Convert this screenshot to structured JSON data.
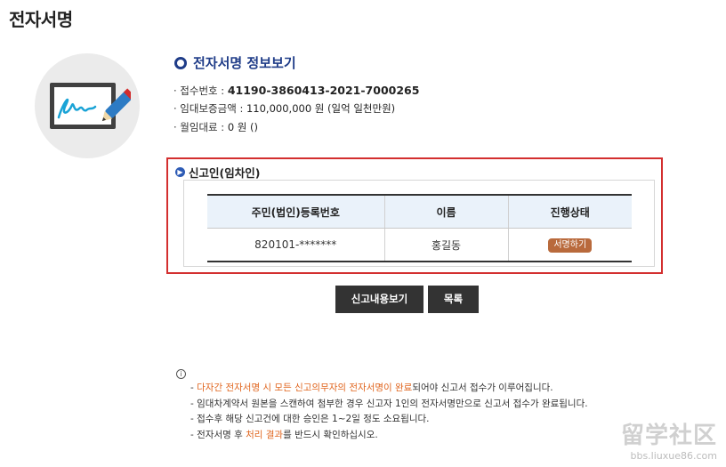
{
  "page": {
    "title": "전자서명"
  },
  "info": {
    "title": "전자서명 정보보기",
    "rows": [
      {
        "label": "· 접수번호 : ",
        "value": "41190-3860413-2021-7000265",
        "strong": true
      },
      {
        "label": "· 임대보증금액 : ",
        "value": "110,000,000 원 (일억 일천만원)",
        "strong": false
      },
      {
        "label": "· 월임대료 : ",
        "value": "0 원 ()",
        "strong": false
      }
    ]
  },
  "section": {
    "label": "신고인(임차인)",
    "table": {
      "headers": [
        "주민(법인)등록번호",
        "이름",
        "진행상태"
      ],
      "rows": [
        {
          "id_number": "820101-*******",
          "name": "홍길동",
          "status": "서명하기"
        }
      ]
    }
  },
  "buttons": {
    "view": "신고내용보기",
    "list": "목록"
  },
  "notice": {
    "icon": "info-circle-icon",
    "lines": [
      [
        {
          "t": "- ",
          "hl": false
        },
        {
          "t": "다자간 전자서명 시 모든 신고의무자의 전자서명이 완료",
          "hl": true
        },
        {
          "t": "되어야 신고서 접수가 이루어집니다.",
          "hl": false
        }
      ],
      [
        {
          "t": "- 임대차계약서 원본을 스캔하여 첨부한 경우 신고자 1인의 전자서명만으로 신고서 접수가 완료됩니다.",
          "hl": false
        }
      ],
      [
        {
          "t": "- 접수후 해당 신고건에 대한 승인은 1~2일 정도 소요됩니다.",
          "hl": false
        }
      ],
      [
        {
          "t": "- 전자서명 후 ",
          "hl": false
        },
        {
          "t": "처리 결과",
          "hl": true
        },
        {
          "t": "를 반드시 확인하십시오.",
          "hl": false
        }
      ]
    ]
  },
  "watermark": {
    "big": "留学社区",
    "small": "bbs.liuxue86.com"
  },
  "colors": {
    "accent": "#1f3c88",
    "highlight": "#e0651e",
    "box_border": "#d32f2f",
    "button_bg": "#333333",
    "badge_bg": "#b96a3c"
  }
}
